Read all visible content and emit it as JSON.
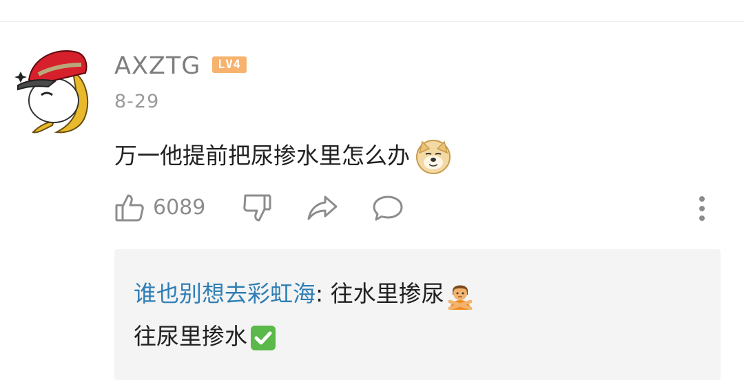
{
  "comment": {
    "username": "AXZTG",
    "level_badge": "LV4",
    "date": "8-29",
    "text": "万一他提前把尿掺水里怎么办",
    "emoji": "doge-emoji"
  },
  "actions": {
    "like_count": "6089",
    "icons": [
      "thumbs-up-icon",
      "thumbs-down-icon",
      "share-icon",
      "reply-icon",
      "more-icon"
    ]
  },
  "reply": {
    "author": "谁也别想去彩虹海",
    "separator": ": ",
    "text_line1": "往水里掺尿",
    "emoji_line1": "person-gesturing-no-emoji",
    "text_line2": "往尿里掺水",
    "emoji_line2": "check-mark-button-emoji"
  },
  "colors": {
    "username": "#7e7e7e",
    "level_badge": "#f7b36e",
    "reply_author": "#2f7fb5",
    "reply_background": "#f4f4f4"
  }
}
